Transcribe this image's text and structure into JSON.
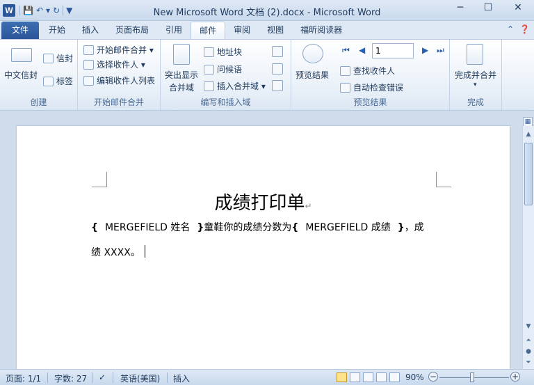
{
  "window": {
    "title": "New Microsoft Word 文档 (2).docx - Microsoft Word",
    "app_logo": "W",
    "minimize": "─",
    "maximize": "☐",
    "close": "✕"
  },
  "tabs": {
    "file": "文件",
    "items": [
      "开始",
      "插入",
      "页面布局",
      "引用",
      "邮件",
      "审阅",
      "视图",
      "福昕阅读器"
    ],
    "active": "邮件"
  },
  "ribbon": {
    "create": {
      "label": "创建",
      "chinese_envelope": "中文信封",
      "envelope": "信封",
      "labels": "标签"
    },
    "start_merge": {
      "label": "开始邮件合并",
      "start": "开始邮件合并",
      "select_recipients": "选择收件人",
      "edit_list": "编辑收件人列表"
    },
    "write_insert": {
      "label": "编写和插入域",
      "highlight_line1": "突出显示",
      "highlight_line2": "合并域",
      "address_block": "地址块",
      "greeting": "问候语",
      "insert_field": "插入合并域"
    },
    "preview": {
      "label": "预览结果",
      "preview_btn": "预览结果",
      "record": "1",
      "find_recipient": "查找收件人",
      "auto_check": "自动检查错误"
    },
    "finish": {
      "label": "完成",
      "finish_merge": "完成并合并"
    }
  },
  "document": {
    "title": "成绩打印单",
    "line1": {
      "field1": "MERGEFIELD  姓名",
      "mid": "童鞋你的成绩分数为",
      "field2": "MERGEFIELD  成绩",
      "tail": "，成"
    },
    "line2": "绩 XXXX。"
  },
  "status": {
    "page": "页面: 1/1",
    "words": "字数: 27",
    "language": "英语(美国)",
    "mode": "插入",
    "zoom": "90%"
  }
}
